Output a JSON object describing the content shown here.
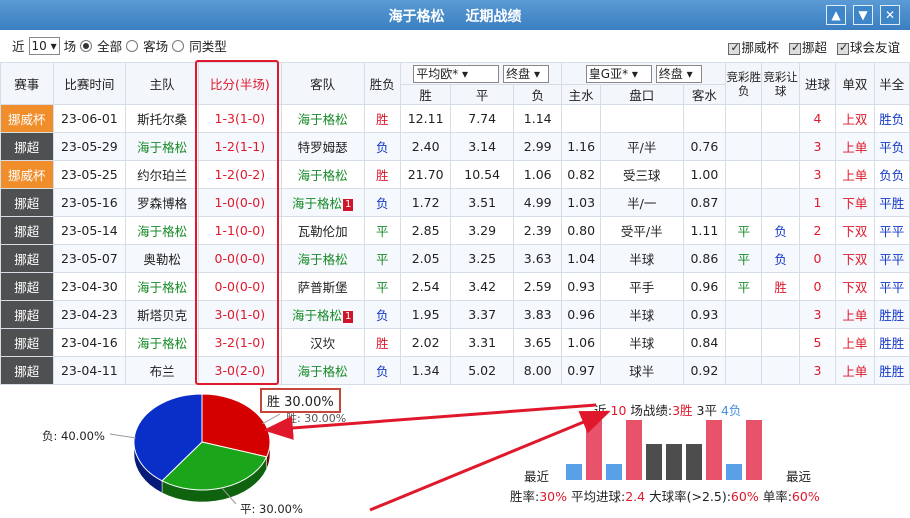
{
  "titlebar": {
    "team": "海于格松",
    "subtitle": "近期战绩",
    "btn_up": "▲",
    "btn_down": "▼",
    "btn_close": "✕"
  },
  "filter": {
    "prefix": "近",
    "count": "10",
    "suffix": "场",
    "options": [
      "全部",
      "客场",
      "同类型"
    ],
    "checks": [
      "挪威杯",
      "挪超",
      "球会友谊"
    ]
  },
  "header": {
    "league": "赛事",
    "date": "比赛时间",
    "home": "主队",
    "score": "比分(半场)",
    "away": "客队",
    "result": "胜负",
    "euro_select": "平均欧*",
    "euro_stage": "终盘",
    "asia_select": "皇G亚*",
    "asia_stage": "终盘",
    "euro_cols": [
      "胜",
      "平",
      "负"
    ],
    "asia_cols": [
      "主水",
      "盘口",
      "客水"
    ],
    "lottery_result": "竞彩胜负",
    "lottery_handicap": "竞彩让球",
    "goals": "进球",
    "oddeven": "单双",
    "half": "半全"
  },
  "rows": [
    {
      "league": "挪威杯",
      "cup": true,
      "date": "23-06-01",
      "home": "斯托尔桑",
      "home_hi": false,
      "score": "1-3",
      "half": "(1-0)",
      "away": "海于格松",
      "away_hi": true,
      "away_tag": "",
      "result": "胜",
      "w": "12.11",
      "d": "7.74",
      "l": "1.14",
      "hw": "",
      "hc": "",
      "aw": "",
      "lr": "",
      "lh": "",
      "goals": "4",
      "oe": "上双",
      "hf": "胜负"
    },
    {
      "league": "挪超",
      "cup": false,
      "date": "23-05-29",
      "home": "海于格松",
      "home_hi": true,
      "score": "1-2",
      "half": "(1-1)",
      "away": "特罗姆瑟",
      "away_hi": false,
      "away_tag": "",
      "result": "负",
      "w": "2.40",
      "d": "3.14",
      "l": "2.99",
      "hw": "1.16",
      "hc": "平/半",
      "aw": "0.76",
      "lr": "",
      "lh": "",
      "goals": "3",
      "oe": "上单",
      "hf": "平负"
    },
    {
      "league": "挪威杯",
      "cup": true,
      "date": "23-05-25",
      "home": "约尔珀兰",
      "home_hi": false,
      "score": "1-2",
      "half": "(0-2)",
      "away": "海于格松",
      "away_hi": true,
      "away_tag": "",
      "result": "胜",
      "w": "21.70",
      "d": "10.54",
      "l": "1.06",
      "hw": "0.82",
      "hc": "受三球",
      "aw": "1.00",
      "lr": "",
      "lh": "",
      "goals": "3",
      "oe": "上单",
      "hf": "负负"
    },
    {
      "league": "挪超",
      "cup": false,
      "date": "23-05-16",
      "home": "罗森博格",
      "home_hi": false,
      "score": "1-0",
      "half": "(0-0)",
      "away": "海于格松",
      "away_hi": true,
      "away_tag": "1",
      "result": "负",
      "w": "1.72",
      "d": "3.51",
      "l": "4.99",
      "hw": "1.03",
      "hc": "半/一",
      "aw": "0.87",
      "lr": "",
      "lh": "",
      "goals": "1",
      "oe": "下单",
      "hf": "平胜"
    },
    {
      "league": "挪超",
      "cup": false,
      "date": "23-05-14",
      "home": "海于格松",
      "home_hi": true,
      "score": "1-1",
      "half": "(0-0)",
      "away": "瓦勒伦加",
      "away_hi": false,
      "away_tag": "",
      "result": "平",
      "w": "2.85",
      "d": "3.29",
      "l": "2.39",
      "hw": "0.80",
      "hc": "受平/半",
      "aw": "1.11",
      "lr": "平",
      "lh": "负",
      "goals": "2",
      "oe": "下双",
      "hf": "平平"
    },
    {
      "league": "挪超",
      "cup": false,
      "date": "23-05-07",
      "home": "奥勒松",
      "home_hi": false,
      "score": "0-0",
      "half": "(0-0)",
      "away": "海于格松",
      "away_hi": true,
      "away_tag": "",
      "result": "平",
      "w": "2.05",
      "d": "3.25",
      "l": "3.63",
      "hw": "1.04",
      "hc": "半球",
      "aw": "0.86",
      "lr": "平",
      "lh": "负",
      "goals": "0",
      "oe": "下双",
      "hf": "平平"
    },
    {
      "league": "挪超",
      "cup": false,
      "date": "23-04-30",
      "home": "海于格松",
      "home_hi": true,
      "score": "0-0",
      "half": "(0-0)",
      "away": "萨普斯堡",
      "away_hi": false,
      "away_tag": "",
      "result": "平",
      "w": "2.54",
      "d": "3.42",
      "l": "2.59",
      "hw": "0.93",
      "hc": "平手",
      "aw": "0.96",
      "lr": "平",
      "lh": "胜",
      "goals": "0",
      "oe": "下双",
      "hf": "平平"
    },
    {
      "league": "挪超",
      "cup": false,
      "date": "23-04-23",
      "home": "斯塔贝克",
      "home_hi": false,
      "score": "3-0",
      "half": "(1-0)",
      "away": "海于格松",
      "away_hi": true,
      "away_tag": "1",
      "result": "负",
      "w": "1.95",
      "d": "3.37",
      "l": "3.83",
      "hw": "0.96",
      "hc": "半球",
      "aw": "0.93",
      "lr": "",
      "lh": "",
      "goals": "3",
      "oe": "上单",
      "hf": "胜胜"
    },
    {
      "league": "挪超",
      "cup": false,
      "date": "23-04-16",
      "home": "海于格松",
      "home_hi": true,
      "score": "3-2",
      "half": "(1-0)",
      "away": "汉坎",
      "away_hi": false,
      "away_tag": "",
      "result": "胜",
      "w": "2.02",
      "d": "3.31",
      "l": "3.65",
      "hw": "1.06",
      "hc": "半球",
      "aw": "0.84",
      "lr": "",
      "lh": "",
      "goals": "5",
      "oe": "上单",
      "hf": "胜胜"
    },
    {
      "league": "挪超",
      "cup": false,
      "date": "23-04-11",
      "home": "布兰",
      "home_hi": false,
      "score": "3-0",
      "half": "(2-0)",
      "away": "海于格松",
      "away_hi": true,
      "away_tag": "",
      "result": "负",
      "w": "1.34",
      "d": "5.02",
      "l": "8.00",
      "hw": "0.97",
      "hc": "球半",
      "aw": "0.92",
      "lr": "",
      "lh": "",
      "goals": "3",
      "oe": "上单",
      "hf": "胜胜"
    }
  ],
  "pie": {
    "slices": [
      {
        "label": "胜",
        "value": 30.0,
        "color": "#d40000"
      },
      {
        "label": "平",
        "value": 30.0,
        "color": "#1aa51a"
      },
      {
        "label": "负",
        "value": 40.0,
        "color": "#0a2ec8"
      }
    ],
    "label_lose": "负: 40.00%",
    "label_draw": "平: 30.00%",
    "tooltip": "胜 30.00%",
    "ghost": "胜: 30.00%"
  },
  "recent": {
    "prefix": "近",
    "count": "10",
    "mid": "场战绩:",
    "wins": "3胜",
    "draws": "3平",
    "losses": "4负",
    "near": "最近",
    "far": "最远",
    "bars": [
      "L",
      "W",
      "L",
      "W",
      "D",
      "D",
      "D",
      "W",
      "L",
      "W"
    ],
    "stat_win_label": "胜率:",
    "stat_win": "30%",
    "stat_goal_label": "平均进球:",
    "stat_goal": "2.4",
    "stat_big_label": "大球率(>2.5):",
    "stat_big": "60%",
    "stat_odd_label": "单率:",
    "stat_odd": "60%"
  }
}
